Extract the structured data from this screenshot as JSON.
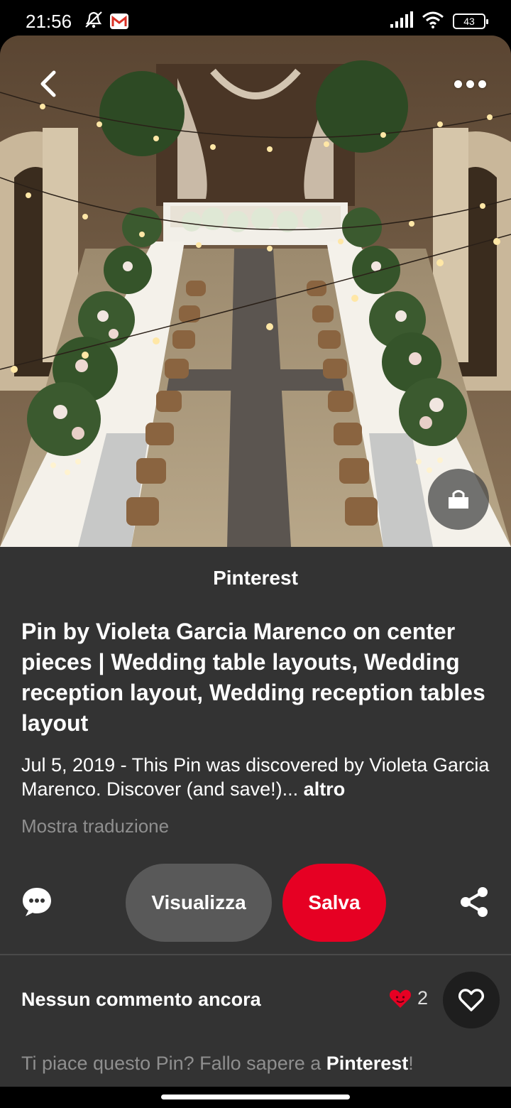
{
  "status_bar": {
    "time": "21:56",
    "battery": "43"
  },
  "pin": {
    "source": "Pinterest",
    "title": "Pin by Violeta Garcia Marenco on center pieces | Wedding table layouts, Wedding reception layout, Wedding reception tables layout",
    "description": "Jul 5, 2019 - This Pin was discovered by Violeta Garcia Marenco. Discover (and save!)...",
    "more_label": "altro",
    "translate_label": "Mostra traduzione"
  },
  "actions": {
    "view_label": "Visualizza",
    "save_label": "Salva"
  },
  "comments": {
    "empty_label": "Nessun commento ancora",
    "reaction_count": "2"
  },
  "prompt": {
    "text": "Ti piace questo Pin? Fallo sapere a ",
    "brand": "Pinterest",
    "suffix": "!"
  },
  "icons": {
    "back": "chevron-left-icon",
    "more": "more-dots-icon",
    "lens": "visual-search-icon",
    "comment": "comment-icon",
    "share": "share-icon",
    "reaction": "heart-icon",
    "like": "heart-outline-icon"
  },
  "colors": {
    "save": "#e60023",
    "panel": "#333333",
    "view": "#595959",
    "reaction": "#e60023"
  }
}
